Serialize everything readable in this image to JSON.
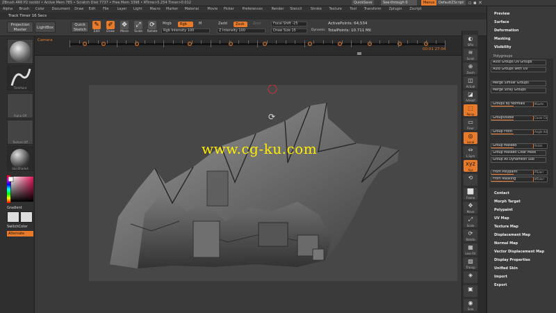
{
  "titlebar": {
    "text": "ZBrush 4R6 P2  rockbt  • Active Mem 785 • Scratch Disk 7737 • Free Mem 3398 • RTime>5.254 Timer>0.012",
    "quicksave": "QuickSave",
    "seethrough": "See-through  0",
    "menus_btn": "Menus",
    "script": "DefaultZScript"
  },
  "menubar": [
    "Alpha",
    "Brush",
    "Color",
    "Document",
    "Draw",
    "Edit",
    "File",
    "Layer",
    "Light",
    "Macro",
    "Marker",
    "Material",
    "Movie",
    "Picker",
    "Preferences",
    "Render",
    "Stencil",
    "Stroke",
    "Texture",
    "Tool",
    "Transform",
    "Zplugin",
    "Zscript"
  ],
  "track_timer": "Track Timer 16 Secs",
  "toolbar": {
    "projection_master": "Projection Master",
    "lightbox": "LightBox",
    "quick_sketch": "Quick Sketch",
    "tools": [
      {
        "label": "Edit",
        "glyph": "✎",
        "active": true
      },
      {
        "label": "Draw",
        "glyph": "✐",
        "active": true
      },
      {
        "label": "Move",
        "glyph": "✥",
        "active": false
      },
      {
        "label": "Scale",
        "glyph": "⤢",
        "active": false
      },
      {
        "label": "Rotate",
        "glyph": "⟳",
        "active": false
      }
    ],
    "mrgb": "Mrgb",
    "rgb": "Rgb",
    "m": "M",
    "rgb_intensity": "Rgb Intensity 100",
    "zadd": "Zadd",
    "zsub": "Zsub",
    "zcut": "Zcut",
    "z_intensity": "Z Intensity 100",
    "focal_shift": "Focal Shift -25",
    "draw_size": "Draw Size 15",
    "dynamic": "Dynamic",
    "active_points": "ActivePoints: 64,534",
    "total_points": "TotalPoints: 10.711 Mil"
  },
  "timeline": {
    "label": "Camera",
    "readout": "00:01 27:04",
    "keys": [
      0.04,
      0.09,
      0.18,
      0.32,
      0.43,
      0.52,
      0.64,
      0.72,
      0.8,
      0.88,
      0.95
    ]
  },
  "leftshelf": [
    {
      "label": "",
      "kind": "sphere"
    },
    {
      "label": "TrimPaint",
      "kind": "stroke"
    },
    {
      "label": "Alpha Off",
      "kind": "blank"
    },
    {
      "label": "Texture Off",
      "kind": "blank"
    },
    {
      "label": "SkinShade4",
      "kind": "material"
    }
  ],
  "color": {
    "gradient": "Gradient",
    "switchcolor": "SwitchColor",
    "alternate": "Alternate"
  },
  "rightshelf": [
    {
      "label": "SPix",
      "glyph": "◐",
      "orange": false
    },
    {
      "label": "Scroll",
      "glyph": "≋",
      "orange": false
    },
    {
      "label": "Zoom",
      "glyph": "⊕",
      "orange": false
    },
    {
      "label": "Actual",
      "glyph": "◫",
      "orange": false
    },
    {
      "label": "AAHalf",
      "glyph": "◪",
      "orange": false
    },
    {
      "label": "Persp",
      "glyph": "⬚",
      "orange": true
    },
    {
      "label": "Floor",
      "glyph": "▭",
      "orange": false
    },
    {
      "label": "Local",
      "glyph": "◎",
      "orange": true
    },
    {
      "label": "L.Sym",
      "glyph": "⇔",
      "orange": false
    },
    {
      "label": "Xyz",
      "glyph": "xyz",
      "orange": true
    },
    {
      "label": "",
      "glyph": "⟲",
      "orange": false
    },
    {
      "label": "Frame",
      "glyph": "⬜",
      "orange": false
    },
    {
      "label": "Move",
      "glyph": "✥",
      "orange": false
    },
    {
      "label": "Scale",
      "glyph": "⤢",
      "orange": false
    },
    {
      "label": "Rotate",
      "glyph": "⟳",
      "orange": false
    },
    {
      "label": "Line Fill",
      "glyph": "▦",
      "orange": false
    },
    {
      "label": "Transp",
      "glyph": "▧",
      "orange": false
    },
    {
      "label": "",
      "glyph": "◈",
      "orange": false
    },
    {
      "label": "",
      "glyph": "▣",
      "orange": false
    },
    {
      "label": "Solo",
      "glyph": "◉",
      "orange": false
    }
  ],
  "rpanel": {
    "headers_top": [
      "Preview",
      "Surface",
      "Deformation",
      "Masking",
      "Visibility"
    ],
    "polygroups": "Polygroups",
    "buttons": [
      {
        "label": "Auto Groups Ov Groups",
        "slider": ""
      },
      {
        "label": "Auto Groups With UV",
        "slider": ""
      },
      {
        "label": "Merge Similar Groups",
        "slider": ""
      },
      {
        "label": "Merge Stray Groups",
        "slider": ""
      },
      {
        "label": "Groups By Normals",
        "slider": "MaxAn"
      },
      {
        "label": "GroupVisible",
        "slider": "Cover Clea"
      },
      {
        "label": "Group Front",
        "slider": "Angle Additi"
      },
      {
        "label": "Group Masked",
        "slider": "Polish"
      },
      {
        "label": "Group Masked Clear Mask",
        "slider": ""
      },
      {
        "label": "Group As Dynamesh Sub",
        "slider": ""
      },
      {
        "label": "From Polypaint",
        "slider": "PTolerr"
      },
      {
        "label": "From Masking",
        "slider": "MTolerr"
      }
    ],
    "headers_bottom": [
      "Contact",
      "Morph Target",
      "Polypaint",
      "UV Map",
      "Texture Map",
      "Displacement Map",
      "Normal Map",
      "Vector Displacement Map",
      "Display Properties",
      "Unified Skin",
      "Import",
      "Export"
    ]
  },
  "watermark": "www.cg-ku.com",
  "colors": {
    "accent": "#e87b2b",
    "panel": "#3a3a3a",
    "canvas": "#474747",
    "watermark": "#ffee00"
  }
}
